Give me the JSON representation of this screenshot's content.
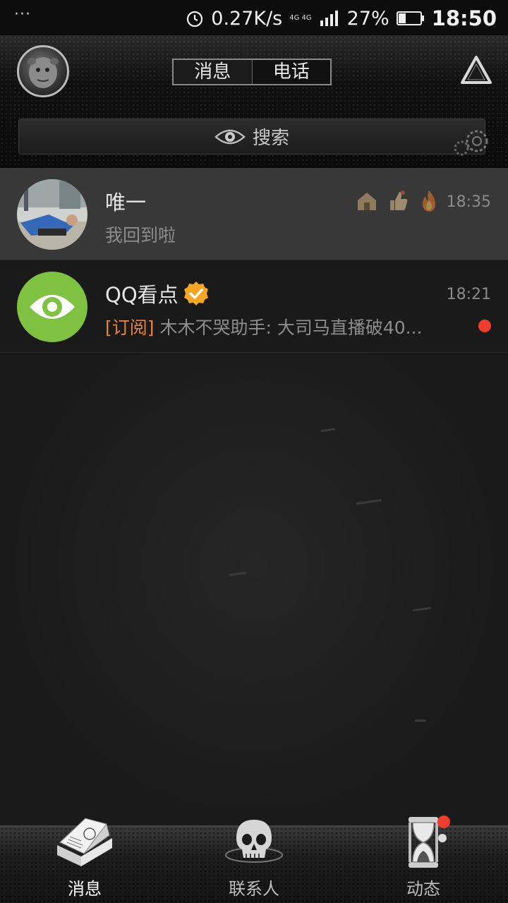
{
  "status_bar": {
    "menu_dots": "···",
    "net_speed": "0.27K/s",
    "network_type": "4G 4G",
    "battery_percent": "27%",
    "time": "18:50"
  },
  "header": {
    "tabs": [
      {
        "label": "消息",
        "active": true
      },
      {
        "label": "电话",
        "active": false
      }
    ],
    "search_placeholder": "搜索"
  },
  "chats": [
    {
      "name": "唯一",
      "message": "我回到啦",
      "time": "18:35",
      "pinned": true,
      "badges": [
        "house-icon",
        "thumbs-up-icon",
        "fire-icon"
      ]
    },
    {
      "name": "QQ看点",
      "verified": true,
      "message_tag": "[订阅]",
      "message": " 木木不哭助手: 大司马直播破40...",
      "time": "18:21",
      "unread": true,
      "avatar_color": "#7fc241"
    }
  ],
  "bottom_nav": [
    {
      "label": "消息",
      "icon": "book-icon",
      "active": true
    },
    {
      "label": "联系人",
      "icon": "skull-icon",
      "active": false
    },
    {
      "label": "动态",
      "icon": "hourglass-icon",
      "active": false,
      "has_dot": true
    }
  ]
}
